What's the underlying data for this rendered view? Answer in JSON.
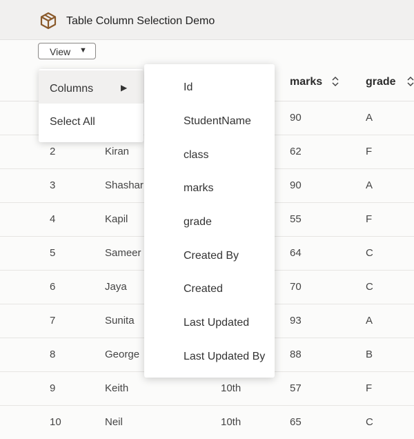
{
  "app": {
    "title": "Table Column Selection Demo",
    "logo_icon": "box-icon",
    "accent": "#8a5a2b"
  },
  "toolbar": {
    "view_label": "View",
    "view_caret_icon": "caret-down-icon"
  },
  "table": {
    "columns": [
      {
        "key": "id",
        "label": ""
      },
      {
        "key": "name",
        "label": ""
      },
      {
        "key": "class",
        "label": ""
      },
      {
        "key": "marks",
        "label": "marks",
        "sortable": true
      },
      {
        "key": "grade",
        "label": "grade",
        "sortable": true
      }
    ],
    "rows": [
      {
        "id": "",
        "name": "",
        "class": "",
        "marks": "90",
        "grade": "A"
      },
      {
        "id": "2",
        "name": "Kiran",
        "class": "",
        "marks": "62",
        "grade": "F"
      },
      {
        "id": "3",
        "name": "Shashar",
        "class": "",
        "marks": "90",
        "grade": "A"
      },
      {
        "id": "4",
        "name": "Kapil",
        "class": "",
        "marks": "55",
        "grade": "F"
      },
      {
        "id": "5",
        "name": "Sameer",
        "class": "",
        "marks": "64",
        "grade": "C"
      },
      {
        "id": "6",
        "name": "Jaya",
        "class": "",
        "marks": "70",
        "grade": "C"
      },
      {
        "id": "7",
        "name": "Sunita",
        "class": "",
        "marks": "93",
        "grade": "A"
      },
      {
        "id": "8",
        "name": "George",
        "class": "",
        "marks": "88",
        "grade": "B"
      },
      {
        "id": "9",
        "name": "Keith",
        "class": "10th",
        "marks": "57",
        "grade": "F"
      },
      {
        "id": "10",
        "name": "Neil",
        "class": "10th",
        "marks": "65",
        "grade": "C"
      }
    ]
  },
  "view_menu": {
    "items": [
      {
        "label": "Columns",
        "has_submenu": true,
        "arrow_icon": "chevron-right-icon"
      },
      {
        "label": "Select All"
      }
    ]
  },
  "columns_submenu": {
    "items": [
      "Id",
      "StudentName",
      "class",
      "marks",
      "grade",
      "Created By",
      "Created",
      "Last Updated",
      "Last Updated By"
    ]
  }
}
